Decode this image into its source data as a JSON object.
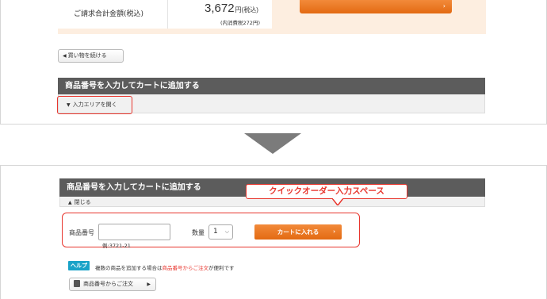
{
  "summary": {
    "total_label": "ご請求合計金額(税込)",
    "total_amount": "3,672",
    "total_unit": "円(税込)",
    "tax_note": "(内消費税272円)",
    "proceed_arrow": "›"
  },
  "continue_shopping_label": "買い物を続ける",
  "quick_order": {
    "title": "商品番号を入力してカートに追加する",
    "open_label": "入力エリアを開く",
    "close_label": "閉じる",
    "callout": "クイックオーダー入力スペース",
    "item_code_label": "商品番号",
    "item_code_value": "",
    "item_code_example": "例:3721-21",
    "quantity_label": "数量",
    "quantity_value": "1",
    "add_to_cart_label": "カートに入れる",
    "help_badge": "ヘルプ",
    "help_text_before": "複数の商品を追加する場合は",
    "help_text_link": "商品番号からご注文",
    "help_text_after": "が便利です",
    "order_by_code_label": "商品番号からご注文"
  },
  "colors": {
    "accent_orange": "#e36a12",
    "highlight_red": "#e8362e",
    "header_gray": "#5c5c5c",
    "help_blue": "#1aa3c8",
    "summary_bg": "#fdeee0"
  },
  "icons": [
    "chevron-left-icon",
    "triangle-down-icon",
    "triangle-up-icon",
    "chevron-down-icon",
    "chevron-right-icon",
    "book-icon",
    "down-arrow-icon"
  ]
}
